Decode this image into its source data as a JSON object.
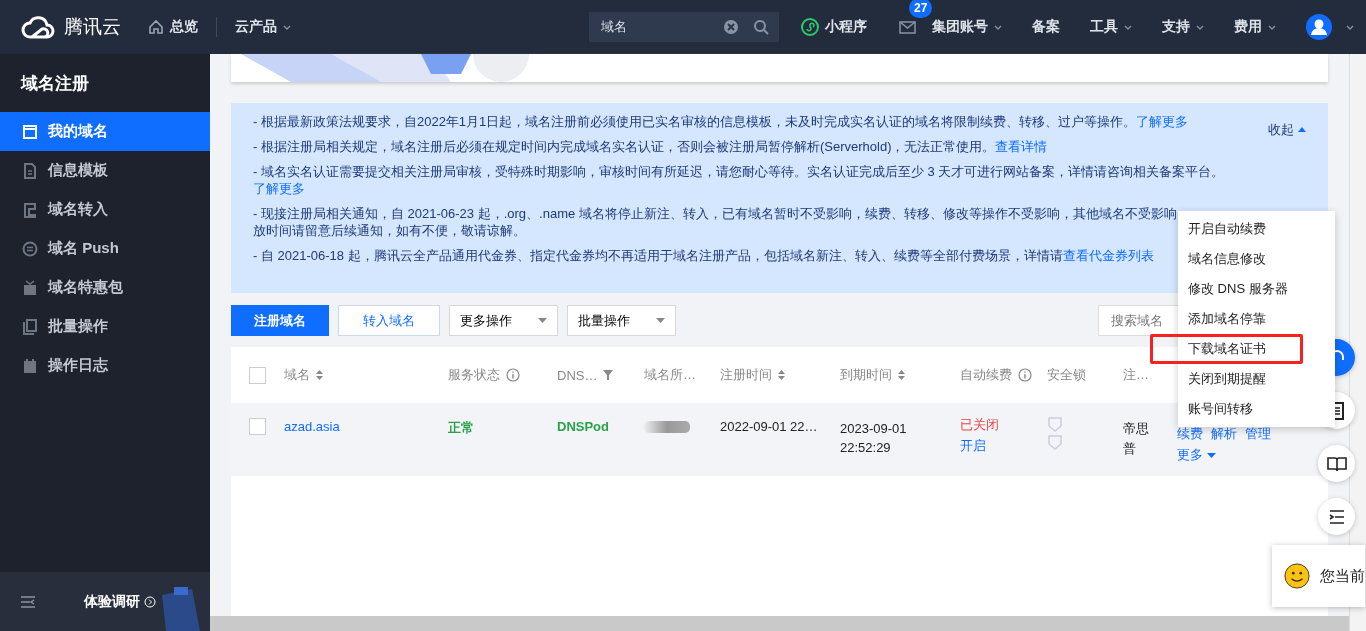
{
  "header": {
    "logo": "腾讯云",
    "nav": [
      {
        "label": "总览",
        "kind": "home"
      },
      {
        "label": "云产品",
        "kind": "dropdown"
      }
    ],
    "search": {
      "value": "域名"
    },
    "miniprogram": "小程序",
    "mail_badge": "27",
    "menus": [
      {
        "label": "集团账号",
        "caret": true
      },
      {
        "label": "备案",
        "caret": false
      },
      {
        "label": "工具",
        "caret": true
      },
      {
        "label": "支持",
        "caret": true
      },
      {
        "label": "费用",
        "caret": true
      }
    ]
  },
  "sidebar": {
    "title": "域名注册",
    "items": [
      {
        "label": "我的域名",
        "selected": true
      },
      {
        "label": "信息模板",
        "selected": false
      },
      {
        "label": "域名转入",
        "selected": false
      },
      {
        "label": "域名 Push",
        "selected": false
      },
      {
        "label": "域名特惠包",
        "selected": false
      },
      {
        "label": "批量操作",
        "selected": false
      },
      {
        "label": "操作日志",
        "selected": false
      }
    ],
    "survey": "体验调研"
  },
  "notice": {
    "collapse": "收起",
    "items": [
      {
        "text": "- 根据最新政策法规要求，自2022年1月1日起，域名注册前必须使用已实名审核的信息模板，未及时完成实名认证的域名将限制续费、转移、过户等操作。",
        "link": "了解更多"
      },
      {
        "text": "- 根据注册局相关规定，域名注册后必须在规定时间内完成域名实名认证，否则会被注册局暂停解析(Serverhold)，无法正常使用。",
        "link": "查看详情"
      },
      {
        "text": "- 域名实名认证需要提交相关注册局审核，受特殊时期影响，审核时间有所延迟，请您耐心等待。实名认证完成后至少 3 天才可进行网站备案，详情请咨询相关备案平台。",
        "link": "了解更多"
      },
      {
        "text": "- 现接注册局相关通知，自 2021-06-23 起，.org、.name 域名将停止新注、转入，已有域名暂时不受影响，续费、转移、修改等操作不受影响，其他域名不受影响",
        "continuation": "放时间请留意后续通知，如有不便，敬请谅解。"
      },
      {
        "text": "- 自 2021-06-18 起，腾讯云全产品通用代金券、指定代金券均不再适用于域名注册产品，包括域名新注、转入、续费等全部付费场景，详情请",
        "link": "查看代金券列表"
      }
    ]
  },
  "toolbar": {
    "buttons": [
      {
        "label": "注册域名",
        "kind": "primary"
      },
      {
        "label": "转入域名",
        "kind": "outline"
      },
      {
        "label": "更多操作",
        "kind": "select"
      },
      {
        "label": "批量操作",
        "kind": "select"
      }
    ],
    "search": {
      "placeholder": "搜索域名"
    }
  },
  "table": {
    "header_checked": false,
    "columns": [
      {
        "label": "域名",
        "kind": "sortable"
      },
      {
        "label": "服务状态",
        "kind": "info"
      },
      {
        "label": "DNS…",
        "kind": "filter"
      },
      {
        "label": "域名所…",
        "kind": "plain"
      },
      {
        "label": "注册时间",
        "kind": "sortable"
      },
      {
        "label": "到期时间",
        "kind": "sortable"
      },
      {
        "label": "自动续费",
        "kind": "info"
      },
      {
        "label": "安全锁",
        "kind": "plain"
      },
      {
        "label": "注…",
        "kind": "plain"
      }
    ],
    "rows": [
      {
        "checked": false,
        "domain": "azad.asia",
        "status": "正常",
        "dns": "DNSPod",
        "registered": "2022-09-01 22…",
        "expires": "2023-09-01 22:52:29",
        "auto_renew": "已关闭",
        "auto_renew_action": "开启",
        "registrar": "帝思普",
        "actions": [
          "续费",
          "解析",
          "管理"
        ],
        "more": "更多"
      }
    ]
  },
  "dropdown": {
    "items": [
      {
        "label": "开启自动续费",
        "highlighted": false
      },
      {
        "label": "域名信息修改",
        "highlighted": false
      },
      {
        "label": "修改 DNS 服务器",
        "highlighted": false
      },
      {
        "label": "添加域名停靠",
        "highlighted": false
      },
      {
        "label": "下载域名证书",
        "highlighted": true
      },
      {
        "label": "关闭到期提醒",
        "highlighted": false
      },
      {
        "label": "账号间转移",
        "highlighted": false
      }
    ]
  },
  "feedback": {
    "text": "您当前"
  }
}
